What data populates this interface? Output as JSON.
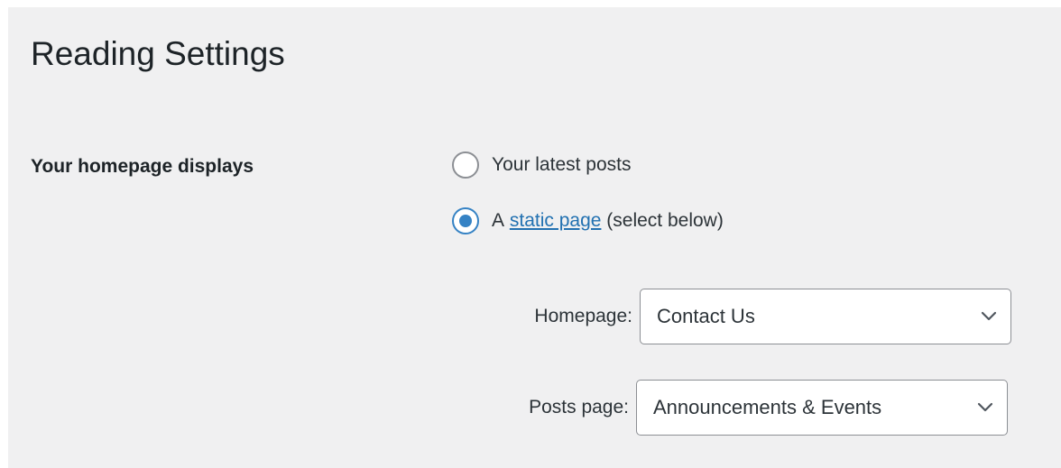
{
  "page": {
    "title": "Reading Settings"
  },
  "homepage_displays": {
    "label": "Your homepage displays",
    "options": [
      {
        "label": "Your latest posts",
        "checked": false
      },
      {
        "prefix": "A",
        "link_text": "static page",
        "suffix": "(select below)",
        "checked": true
      }
    ]
  },
  "homepage_select": {
    "label": "Homepage:",
    "value": "Contact Us"
  },
  "posts_page_select": {
    "label": "Posts page:",
    "value": "Announcements & Events"
  },
  "colors": {
    "background": "#f0f0f1",
    "accent": "#3582c4",
    "link": "#2271b1",
    "border": "#8c8f94"
  },
  "icons": {
    "dropdown": "chevron-down-icon"
  }
}
